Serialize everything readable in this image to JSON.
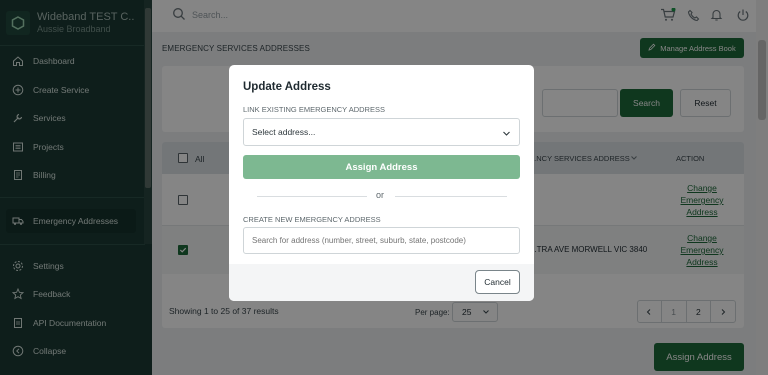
{
  "org": {
    "name": "Wideband TEST C...",
    "subtitle": "Aussie Broadband"
  },
  "sidebar": {
    "items": [
      {
        "label": "Dashboard"
      },
      {
        "label": "Create Service"
      },
      {
        "label": "Services"
      },
      {
        "label": "Projects"
      },
      {
        "label": "Billing"
      },
      {
        "label": "Emergency Addresses"
      },
      {
        "label": "Settings"
      },
      {
        "label": "Feedback"
      },
      {
        "label": "API Documentation"
      },
      {
        "label": "Collapse"
      }
    ]
  },
  "topbar": {
    "search_placeholder": "Search..."
  },
  "page": {
    "breadcrumb": "EMERGENCY SERVICES ADDRESSES",
    "manage_button": "Manage Address Book",
    "search_button": "Search",
    "reset_button": "Reset",
    "table": {
      "header_all": "All",
      "header_address": "...NCY SERVICES ADDRESS",
      "header_action": "ACTION",
      "rows": [
        {
          "address": "",
          "action": "Change Emergency Address",
          "checked": false
        },
        {
          "address": "...TRA AVE MORWELL VIC 3840",
          "action": "Change Emergency Address",
          "checked": true
        }
      ]
    },
    "pagination": {
      "showing": "Showing 1 to 25 of 37 results",
      "per_page_label": "Per page:",
      "per_page_value": "25",
      "pages": [
        "1",
        "2"
      ]
    },
    "assign_button": "Assign Address"
  },
  "modal": {
    "title": "Update Address",
    "link_label": "LINK EXISTING EMERGENCY ADDRESS",
    "select_value": "Select address...",
    "assign_button": "Assign Address",
    "or_text": "or",
    "create_label": "CREATE NEW EMERGENCY ADDRESS",
    "address_placeholder": "Search for address (number, street, suburb, state, postcode)",
    "cancel_button": "Cancel"
  },
  "colors": {
    "brand_green": "#1e6a3a",
    "sidebar_bg": "#1c3b35",
    "disabled_green": "#7db891"
  }
}
